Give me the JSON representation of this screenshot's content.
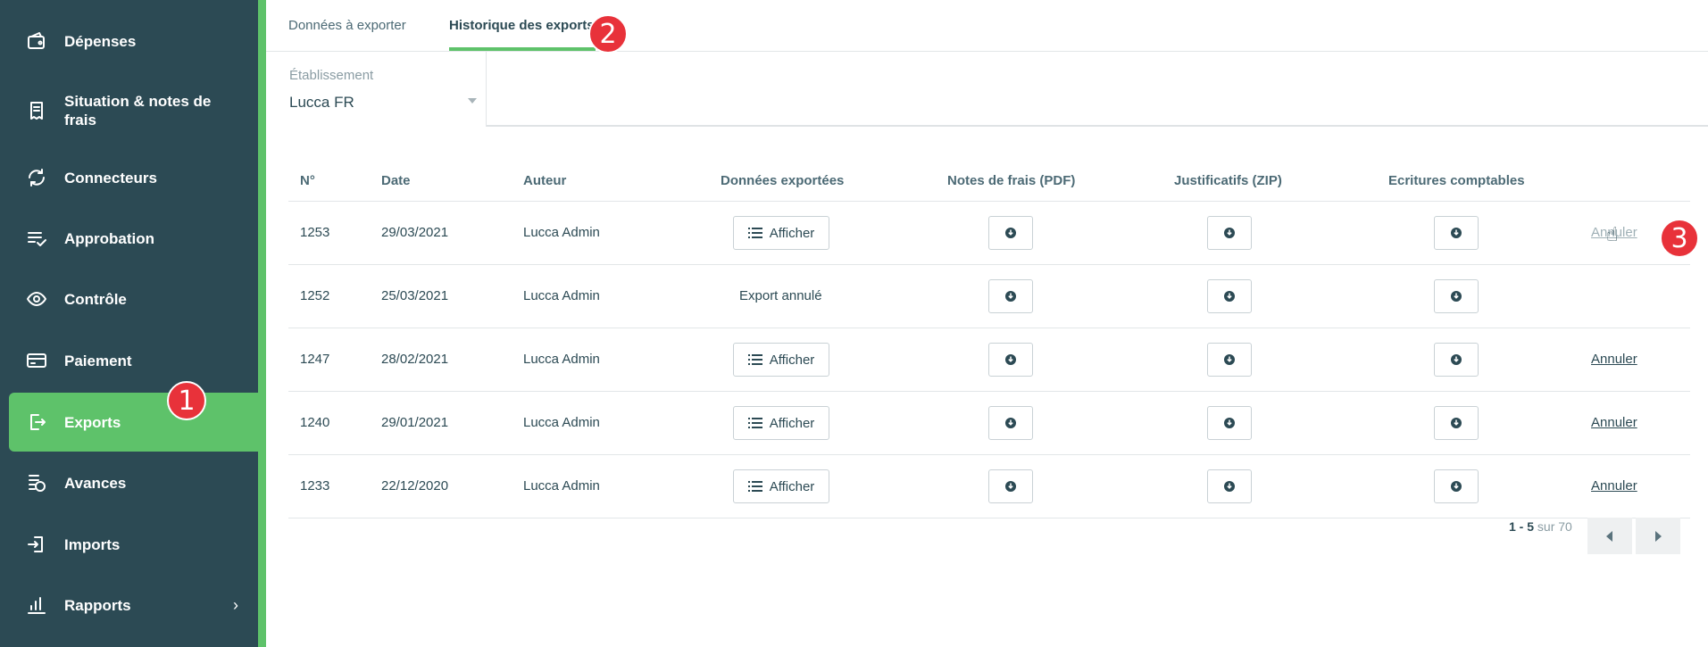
{
  "sidebar": {
    "items": [
      {
        "label": "Dépenses",
        "icon": "wallet-icon"
      },
      {
        "label": "Situation & notes de frais",
        "icon": "receipt-icon"
      },
      {
        "label": "Connecteurs",
        "icon": "sync-icon"
      },
      {
        "label": "Approbation",
        "icon": "checklist-icon"
      },
      {
        "label": "Contrôle",
        "icon": "eye-icon"
      },
      {
        "label": "Paiement",
        "icon": "card-icon"
      },
      {
        "label": "Exports",
        "icon": "export-icon",
        "active": true
      },
      {
        "label": "Avances",
        "icon": "coins-icon"
      },
      {
        "label": "Imports",
        "icon": "import-icon"
      },
      {
        "label": "Rapports",
        "icon": "chart-icon",
        "chevron": "›"
      }
    ],
    "accent_color": "#5ec26a",
    "bg_color": "#2c4a54"
  },
  "badges": {
    "one": "1",
    "two": "2",
    "three": "3"
  },
  "tabs": [
    {
      "label": "Données à exporter"
    },
    {
      "label": "Historique des exports",
      "active": true
    }
  ],
  "filter": {
    "label": "Établissement",
    "value": "Lucca FR"
  },
  "table": {
    "headers": [
      "N°",
      "Date",
      "Auteur",
      "Données exportées",
      "Notes de frais (PDF)",
      "Justificatifs (ZIP)",
      "Ecritures comptables"
    ],
    "show_label": "Afficher",
    "cancel_label": "Annuler",
    "cancelled_label": "Export annulé",
    "rows": [
      {
        "num": "1253",
        "date": "29/03/2021",
        "author": "Lucca Admin"
      },
      {
        "num": "1252",
        "date": "25/03/2021",
        "author": "Lucca Admin"
      },
      {
        "num": "1247",
        "date": "28/02/2021",
        "author": "Lucca Admin"
      },
      {
        "num": "1240",
        "date": "29/01/2021",
        "author": "Lucca Admin"
      },
      {
        "num": "1233",
        "date": "22/12/2020",
        "author": "Lucca Admin"
      }
    ]
  },
  "pagination": {
    "range": "1 - 5",
    "of": "sur 70"
  }
}
